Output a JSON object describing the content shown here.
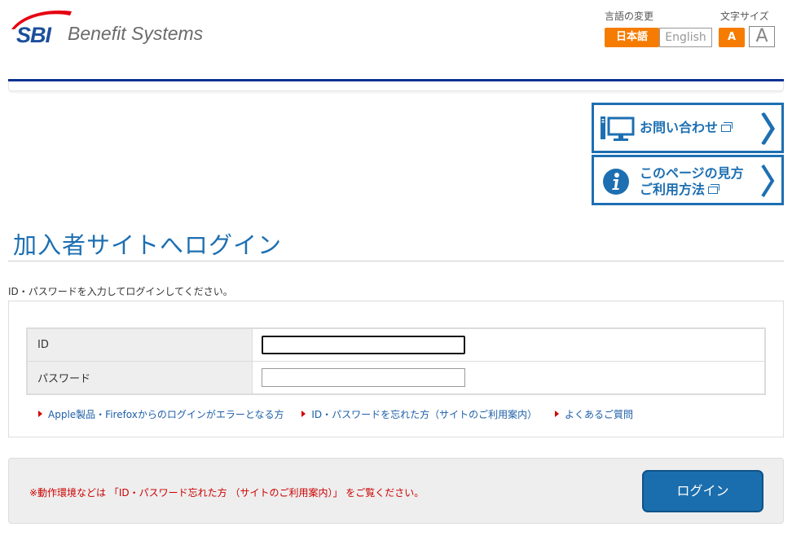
{
  "header": {
    "logo_mark": "SBI",
    "logo_text": "Benefit Systems",
    "language_label": "言語の変更",
    "language_options": [
      {
        "label": "日本語",
        "selected": true
      },
      {
        "label": "English",
        "selected": false
      }
    ],
    "font_size_label": "文字サイズ",
    "font_size_options": [
      {
        "label": "A",
        "size": "small",
        "selected": true
      },
      {
        "label": "A",
        "size": "large",
        "selected": false
      }
    ]
  },
  "side_banners": [
    {
      "label_line1": "お問い合わせ",
      "label_line2": "",
      "icon": "monitor-icon",
      "external": true
    },
    {
      "label_line1": "このページの見方",
      "label_line2": "ご利用方法",
      "icon": "info-icon",
      "external": true
    }
  ],
  "page": {
    "title": "加入者サイトへログイン",
    "instruction": "ID・パスワードを入力してログインしてください。"
  },
  "form": {
    "fields": [
      {
        "label": "ID",
        "value": "",
        "placeholder": "",
        "type": "text",
        "focused": true
      },
      {
        "label": "パスワード",
        "value": "",
        "placeholder": "",
        "type": "password",
        "focused": false
      }
    ],
    "links": [
      "Apple製品・Firefoxからのログインがエラーとなる方",
      "ID・パスワードを忘れた方（サイトのご利用案内）",
      "よくあるご質問"
    ]
  },
  "footer_panel": {
    "notice": "※動作環境などは 「ID・パスワード忘れた方 （サイトのご利用案内）」 をご覧ください。",
    "login_button": "ログイン"
  },
  "colors": {
    "brand_blue": "#1d6fb2",
    "navy_line": "#0b3190",
    "orange": "#f57c00",
    "notice_red": "#cc0000",
    "button_blue": "#1b6ead"
  }
}
